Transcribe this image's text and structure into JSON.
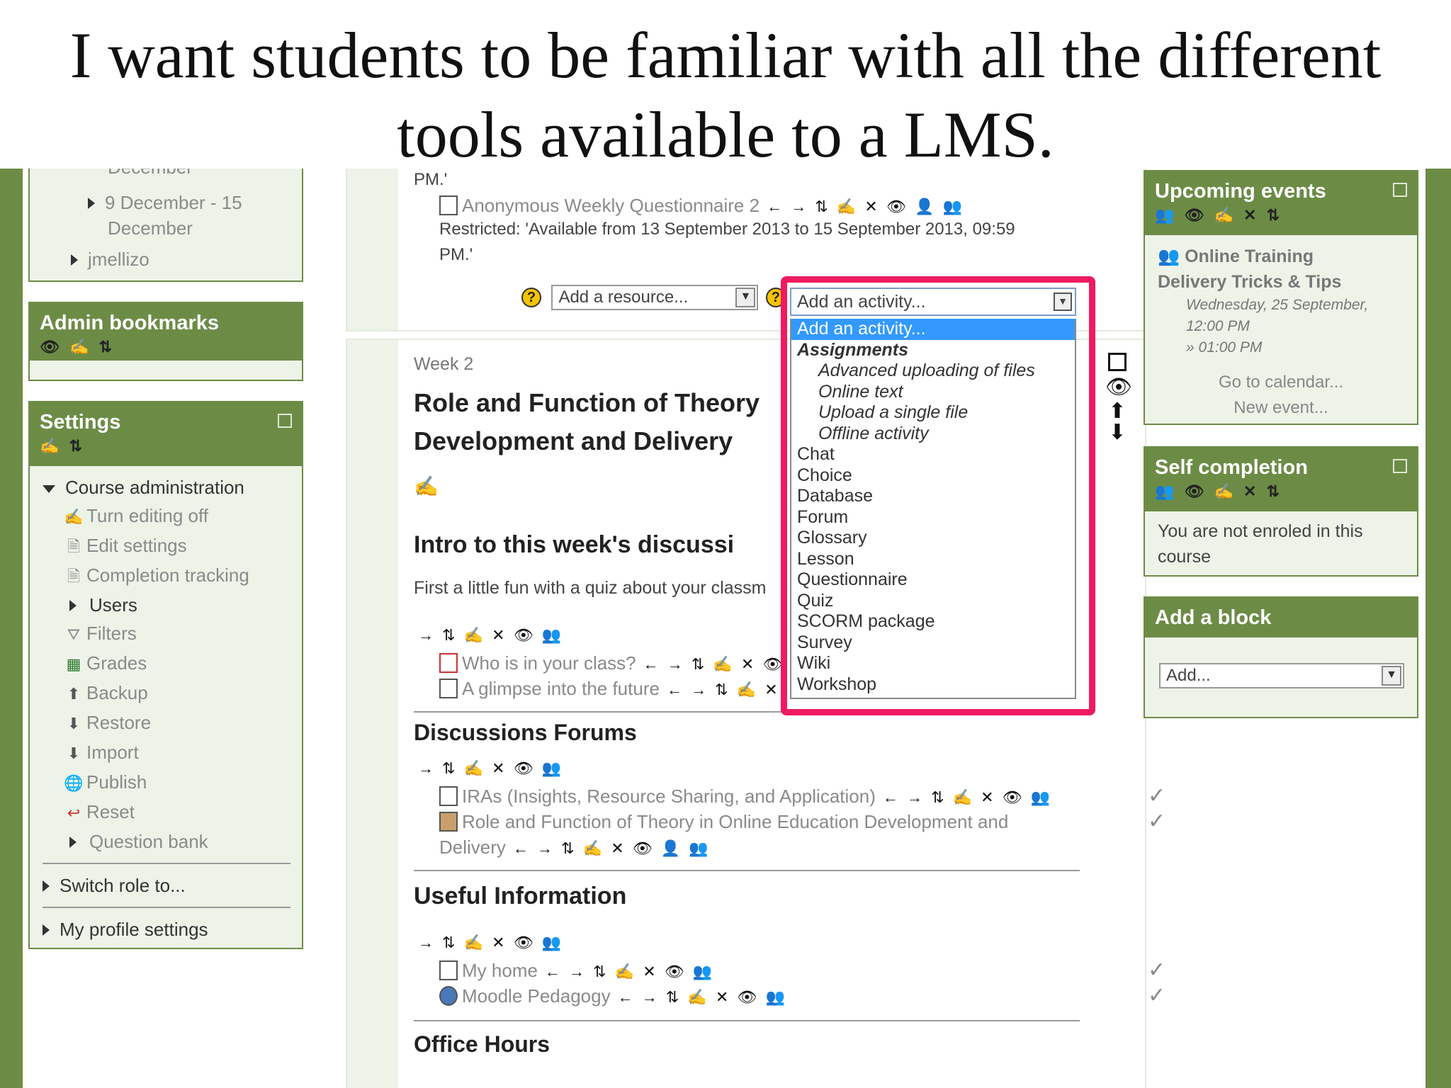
{
  "slide": {
    "title_line1": "I want students to be familiar with all the different",
    "title_line2": "tools available to a LMS."
  },
  "left": {
    "nav_partial": {
      "cut_text": "December",
      "week_label_1": "9 December - 15",
      "week_label_2": "December",
      "user": "jmellizo"
    },
    "admin_bookmarks": {
      "title": "Admin bookmarks",
      "icons": "👁 ✍ ⇅"
    },
    "settings": {
      "title": "Settings",
      "icons": "✍ ⇅",
      "course_admin": "Course administration",
      "items": [
        {
          "label": "Turn editing off",
          "icon": "✍"
        },
        {
          "label": "Edit settings",
          "icon": "🗎"
        },
        {
          "label": "Completion tracking",
          "icon": "🗎"
        },
        {
          "label": "Users",
          "icon": ""
        },
        {
          "label": "Filters",
          "icon": "⛛"
        },
        {
          "label": "Grades",
          "icon": "▦"
        },
        {
          "label": "Backup",
          "icon": "⬆"
        },
        {
          "label": "Restore",
          "icon": "⬇"
        },
        {
          "label": "Import",
          "icon": "⬇"
        },
        {
          "label": "Publish",
          "icon": "🌐"
        },
        {
          "label": "Reset",
          "icon": "↩"
        },
        {
          "label": "Question bank",
          "icon": ""
        }
      ],
      "switch_role": "Switch role to...",
      "profile": "My profile settings"
    }
  },
  "main": {
    "pm_text": "PM.'",
    "questionnaire_link": "Anonymous Weekly Questionnaire 2",
    "restricted_line1": "Restricted: 'Available from 13 September 2013 to 15 September 2013, 09:59",
    "restricted_line2": "PM.'",
    "edit_icons_full": "← → ⇅ ✍ ✕ 👁 👤 👥",
    "edit_icons_short": "→ ⇅ ✍ ✕ 👁 👥",
    "add_resource": "Add a resource...",
    "add_activity": "Add an activity...",
    "week2": {
      "label": "Week 2",
      "title_line1": "Role and Function of Theory",
      "title_line2": "Development and Delivery",
      "intro_heading": "Intro to this week's discussi",
      "intro_text": "First a little fun with a quiz about your classm",
      "activities": [
        {
          "label": "Who is in your class?",
          "icons": "← → ⇅ ✍ ✕ 👁"
        },
        {
          "label": "A glimpse into the future",
          "icons": "← → ⇅ ✍ ✕"
        }
      ],
      "forums_heading": "Discussions Forums",
      "forums": [
        {
          "label": "IRAs (Insights, Resource Sharing, and Application)",
          "icons": "← → ⇅ ✍ ✕ 👁 👥"
        },
        {
          "label": "Role and Function of Theory in Online Education Development and",
          "label2": "Delivery",
          "icons": "← → ⇅ ✍ ✕ 👁 👤 👥"
        }
      ],
      "useful_heading": "Useful Information",
      "useful": [
        {
          "label": "My home",
          "icons": "← → ⇅ ✍ ✕ 👁 👥"
        },
        {
          "label": "Moodle Pedagogy",
          "icons": "← → ⇅ ✍ ✕ 👁 👥"
        }
      ],
      "office_heading": "Office Hours"
    }
  },
  "dropdown": {
    "current": "Add an activity...",
    "options": [
      {
        "label": "Add an activity...",
        "kind": "selected"
      },
      {
        "label": "Assignments",
        "kind": "group"
      },
      {
        "label": "Advanced uploading of files",
        "kind": "sub"
      },
      {
        "label": "Online text",
        "kind": "sub"
      },
      {
        "label": "Upload a single file",
        "kind": "sub"
      },
      {
        "label": "Offline activity",
        "kind": "sub"
      },
      {
        "label": "Chat",
        "kind": "item"
      },
      {
        "label": "Choice",
        "kind": "item"
      },
      {
        "label": "Database",
        "kind": "item"
      },
      {
        "label": "Forum",
        "kind": "item"
      },
      {
        "label": "Glossary",
        "kind": "item"
      },
      {
        "label": "Lesson",
        "kind": "item"
      },
      {
        "label": "Questionnaire",
        "kind": "item"
      },
      {
        "label": "Quiz",
        "kind": "item"
      },
      {
        "label": "SCORM package",
        "kind": "item"
      },
      {
        "label": "Survey",
        "kind": "item"
      },
      {
        "label": "Wiki",
        "kind": "item"
      },
      {
        "label": "Workshop",
        "kind": "item"
      }
    ]
  },
  "right": {
    "upcoming": {
      "title": "Upcoming events",
      "icons": "👥 👁 ✍ ✕ ⇅",
      "event_title_1": "Online Training",
      "event_title_2": "Delivery Tricks & Tips",
      "date_line1": "Wednesday, 25 September,",
      "date_line2": "12:00 PM",
      "date_line3": "» 01:00 PM",
      "go_calendar": "Go to calendar...",
      "new_event": "New event..."
    },
    "self_completion": {
      "title": "Self completion",
      "icons": "👥 👁 ✍ ✕ ⇅",
      "text_line1": "You are not enroled in this",
      "text_line2": "course"
    },
    "add_block": {
      "title": "Add a block",
      "select": "Add..."
    }
  },
  "colors": {
    "brand_green": "#6c8c46",
    "highlight": "#ee1b60",
    "selected": "#3399ff"
  }
}
